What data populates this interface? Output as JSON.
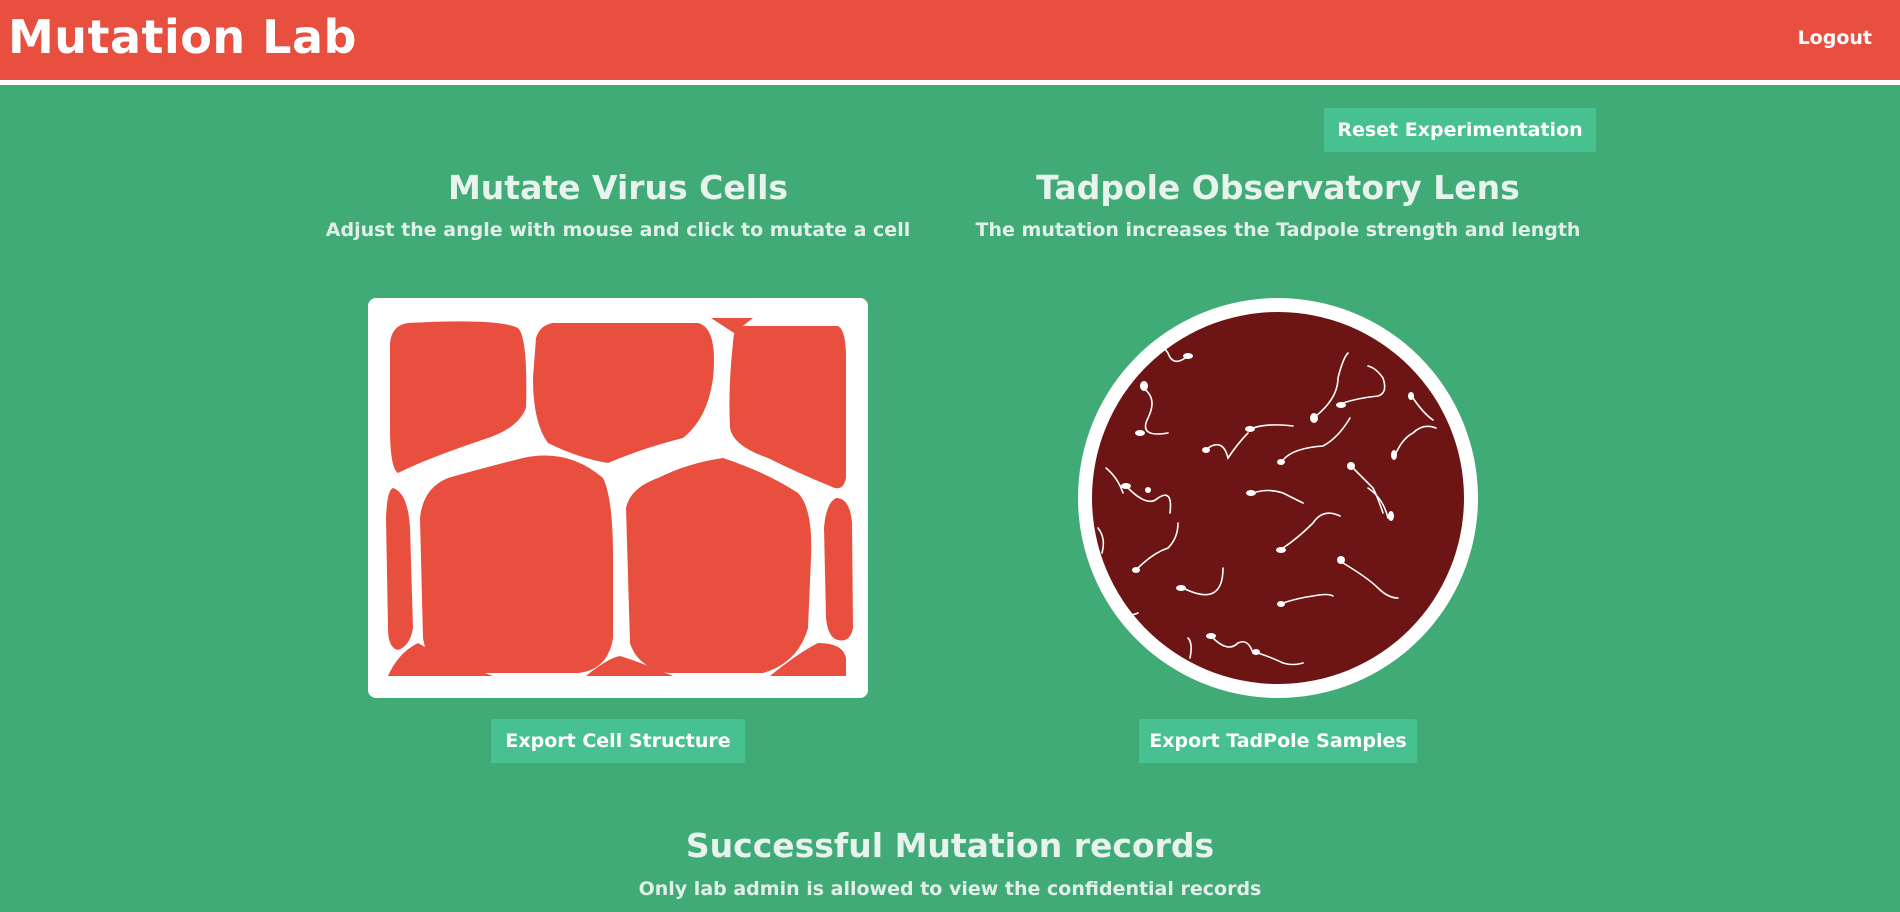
{
  "header": {
    "brand": "Mutation Lab",
    "logout_label": "Logout"
  },
  "controls": {
    "reset_label": "Reset Experimentation"
  },
  "virus_panel": {
    "title": "Mutate Virus Cells",
    "subtitle": "Adjust the angle with mouse and click to mutate a cell",
    "export_label": "Export Cell Structure"
  },
  "tadpole_panel": {
    "title": "Tadpole Observatory Lens",
    "subtitle": "The mutation increases the Tadpole strength and length",
    "export_label": "Export TadPole Samples"
  },
  "records": {
    "title": "Successful Mutation records",
    "subtitle": "Only lab admin is allowed to view the confidential records"
  },
  "colors": {
    "background": "#41ab77",
    "header": "#e84f3f",
    "button": "#48c191",
    "cell": "#e84f3f",
    "lens_inner": "#6d1414"
  }
}
